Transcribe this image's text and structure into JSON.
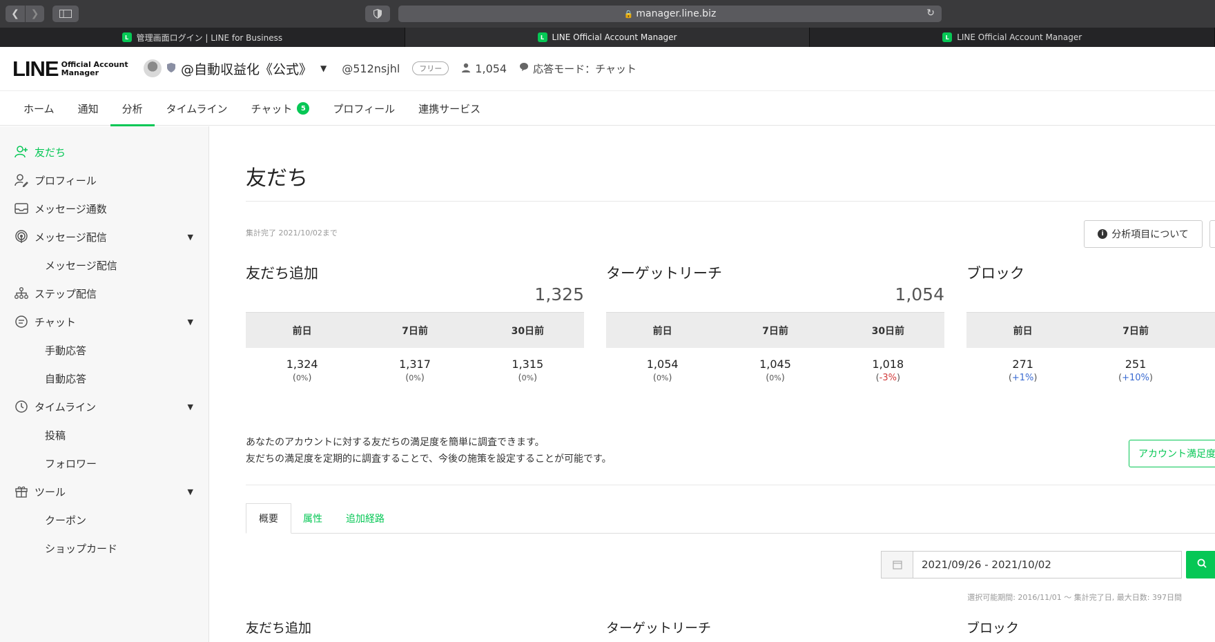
{
  "browser": {
    "url": "manager.line.biz",
    "tabs": [
      {
        "label": "管理画面ログイン | LINE for Business"
      },
      {
        "label": "LINE Official Account Manager"
      },
      {
        "label": "LINE Official Account Manager"
      }
    ]
  },
  "header": {
    "logo_main": "LINE",
    "logo_sub_1": "Official Account",
    "logo_sub_2": "Manager",
    "account_name": "@自動収益化《公式》",
    "account_id": "@512nsjhl",
    "plan": "フリー",
    "friend_count": "1,054",
    "response_mode": "応答モード：チャット"
  },
  "topnav": {
    "home": "ホーム",
    "notice": "通知",
    "analysis": "分析",
    "timeline": "タイムライン",
    "chat": "チャット",
    "chat_badge": "5",
    "profile": "プロフィール",
    "services": "連携サービス"
  },
  "sidebar": {
    "friends": "友だち",
    "profile": "プロフィール",
    "message_count": "メッセージ通数",
    "message_delivery": "メッセージ配信",
    "message_delivery_sub": "メッセージ配信",
    "step": "ステップ配信",
    "chat": "チャット",
    "manual": "手動応答",
    "auto": "自動応答",
    "timeline": "タイムライン",
    "posts": "投稿",
    "followers": "フォロワー",
    "tools": "ツール",
    "coupon": "クーポン",
    "shopcard": "ショップカード"
  },
  "main": {
    "title": "友だち",
    "as_of": "集計完了 2021/10/02まで",
    "about_label": "分析項目について",
    "kpis": [
      {
        "title": "友だち追加",
        "total": "1,325",
        "h1": "前日",
        "h2": "7日前",
        "h3": "30日前",
        "v1": "1,324",
        "p1": "0%",
        "v2": "1,317",
        "p2": "0%",
        "v3": "1,315",
        "p3": "0%"
      },
      {
        "title": "ターゲットリーチ",
        "total": "1,054",
        "h1": "前日",
        "h2": "7日前",
        "h3": "30日前",
        "v1": "1,054",
        "p1": "0%",
        "v2": "1,045",
        "p2": "0%",
        "v3": "1,018",
        "p3": "-3%"
      },
      {
        "title": "ブロック",
        "total": "",
        "h1": "前日",
        "h2": "7日前",
        "h3": "",
        "v1": "271",
        "p1": "+1%",
        "v2": "251",
        "p2": "+10%",
        "v3": "",
        "p3": ""
      }
    ],
    "survey_line1": "あなたのアカウントに対する友だちの満足度を簡単に調査できます。",
    "survey_line2": "友だちの満足度を定期的に調査することで、今後の施策を設定することが可能です。",
    "survey_button": "アカウント満足度",
    "subtabs": {
      "overview": "概要",
      "attributes": "属性",
      "routes": "追加経路"
    },
    "date_range": "2021/09/26 - 2021/10/02",
    "range_note": "選択可能期間: 2016/11/01 〜 集計完了日, 最大日数: 397日間",
    "section_titles": {
      "s1": "友だち追加",
      "s2": "ターゲットリーチ",
      "s3": "ブロック"
    }
  },
  "colors": {
    "brand_green": "#06c755",
    "negative": "#d23a3a",
    "positive": "#3a6bd2"
  }
}
